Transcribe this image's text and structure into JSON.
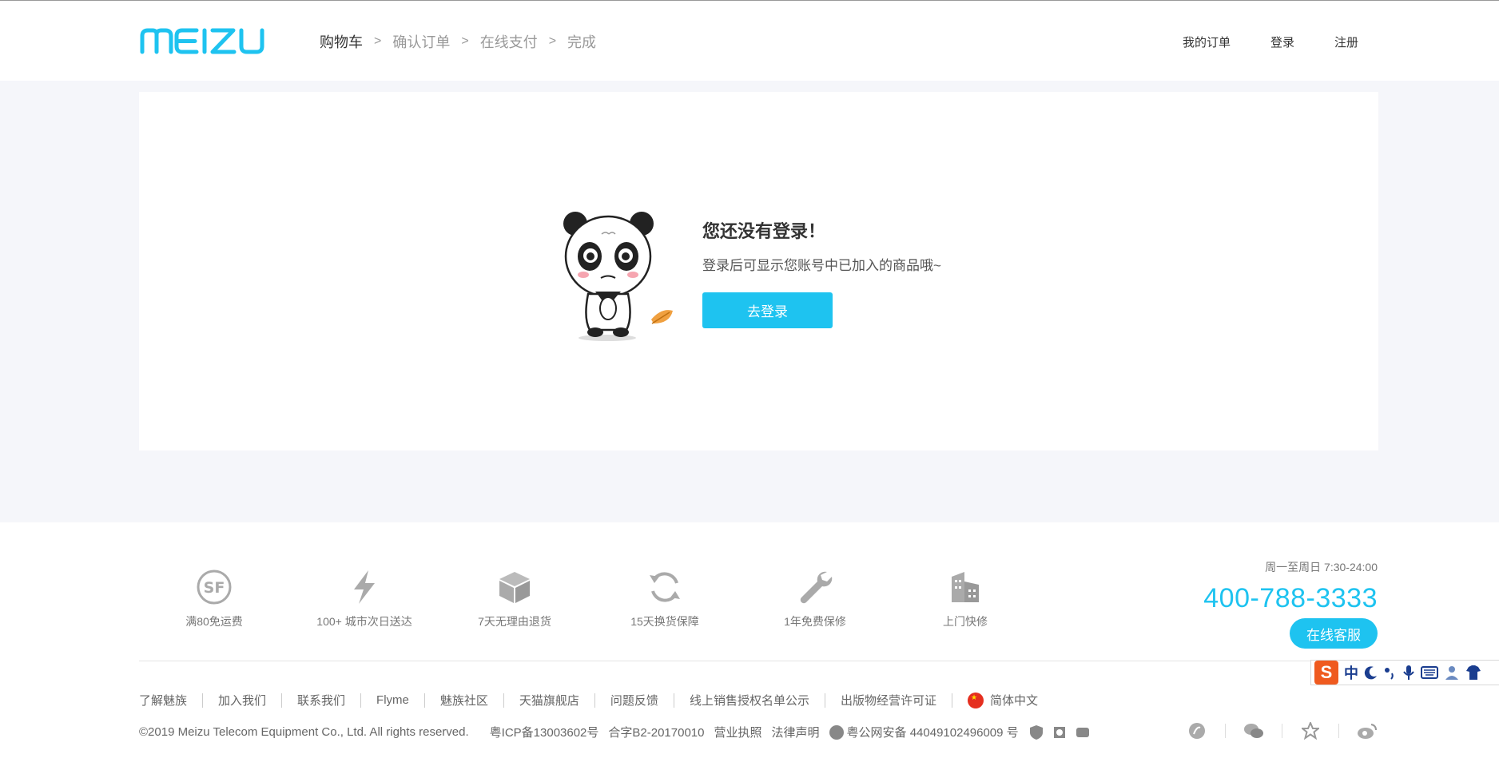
{
  "brand": {
    "logo_text": "MEIZU",
    "accent": "#1EC3F0"
  },
  "steps": [
    {
      "label": "购物车",
      "active": true
    },
    {
      "label": "确认订单",
      "active": false
    },
    {
      "label": "在线支付",
      "active": false
    },
    {
      "label": "完成",
      "active": false
    }
  ],
  "step_separator": ">",
  "topnav": {
    "orders": "我的订单",
    "login": "登录",
    "register": "注册"
  },
  "empty_state": {
    "title": "您还没有登录！",
    "subtitle": "登录后可显示您账号中已加入的商品哦~",
    "button": "去登录"
  },
  "services": [
    {
      "icon": "sf-express-icon",
      "label": "满80免运费"
    },
    {
      "icon": "lightning-icon",
      "label": "100+ 城市次日送达"
    },
    {
      "icon": "box-icon",
      "label": "7天无理由退货"
    },
    {
      "icon": "refresh-icon",
      "label": "15天换货保障"
    },
    {
      "icon": "wrench-icon",
      "label": "1年免费保修"
    },
    {
      "icon": "building-icon",
      "label": "上门快修"
    }
  ],
  "contact": {
    "hours": "周一至周日 7:30-24:00",
    "phone": "400-788-3333",
    "online_service": "在线客服"
  },
  "footer_links": [
    "了解魅族",
    "加入我们",
    "联系我们",
    "Flyme",
    "魅族社区",
    "天猫旗舰店",
    "问题反馈",
    "线上销售授权名单公示",
    "出版物经营许可证"
  ],
  "language": "简体中文",
  "copyright": "©2019 Meizu Telecom Equipment Co., Ltd. All rights reserved.",
  "icp": "粤ICP备13003602号",
  "license_b2": "合字B2-20170010",
  "business_license": "营业执照",
  "legal": "法律声明",
  "police": "粤公网安备 44049102496009 号",
  "social": [
    "flyme-icon",
    "wechat-icon",
    "star-icon",
    "weibo-icon"
  ],
  "ime": {
    "logo": "S",
    "mode": "中"
  }
}
